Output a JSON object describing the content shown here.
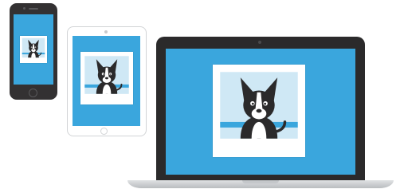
{
  "devices": {
    "phone": {
      "type": "smartphone",
      "screen_color": "#3aa6dd"
    },
    "tablet": {
      "type": "tablet",
      "screen_color": "#3aa6dd"
    },
    "laptop": {
      "type": "laptop",
      "screen_color": "#3aa6dd"
    }
  },
  "photo": {
    "subject": "dog-illustration",
    "frame_color": "#ffffff",
    "sky_color": "#cfe8f5",
    "ground_color": "#3aa6dd",
    "dog_color": "#2b2a2b"
  }
}
